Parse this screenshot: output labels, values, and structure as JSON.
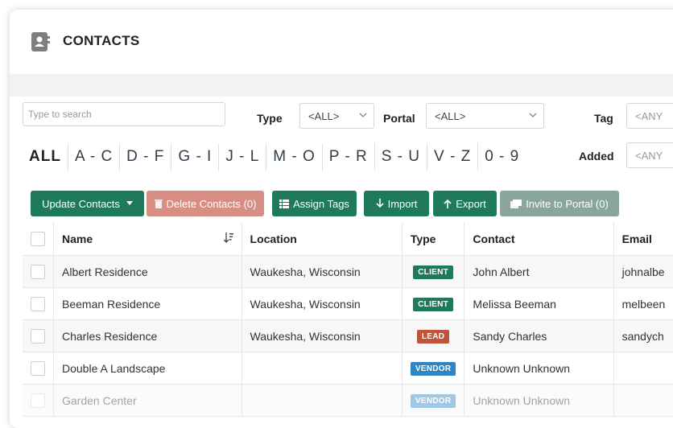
{
  "header": {
    "title": "CONTACTS",
    "icon": "contact-book-icon"
  },
  "filters": {
    "search_placeholder": "Type to search",
    "type_label": "Type",
    "type_value": "<ALL>",
    "portal_label": "Portal",
    "portal_value": "<ALL>",
    "tag_label": "Tag",
    "tag_value": "<ANY",
    "added_label": "Added",
    "added_value": "<ANY"
  },
  "alphabet": [
    "ALL",
    "A - C",
    "D - F",
    "G - I",
    "J - L",
    "M - O",
    "P - R",
    "S - U",
    "V - Z",
    "0 - 9"
  ],
  "toolbar": {
    "update": "Update Contacts",
    "delete": "Delete Contacts (0)",
    "assign": "Assign Tags",
    "import": "Import",
    "export": "Export",
    "invite": "Invite to Portal (0)"
  },
  "table": {
    "columns": [
      "Name",
      "Location",
      "Type",
      "Contact",
      "Email"
    ],
    "rows": [
      {
        "name": "Albert Residence",
        "location": "Waukesha, Wisconsin",
        "type": "CLIENT",
        "contact": "John Albert",
        "email": "johnalbe"
      },
      {
        "name": "Beeman Residence",
        "location": "Waukesha, Wisconsin",
        "type": "CLIENT",
        "contact": "Melissa Beeman",
        "email": "melbeen"
      },
      {
        "name": "Charles Residence",
        "location": "Waukesha, Wisconsin",
        "type": "LEAD",
        "contact": "Sandy Charles",
        "email": "sandych"
      },
      {
        "name": "Double A Landscape",
        "location": "",
        "type": "VENDOR",
        "contact": "Unknown Unknown",
        "email": ""
      },
      {
        "name": "Garden Center",
        "location": "",
        "type": "VENDOR",
        "contact": "Unknown Unknown",
        "email": ""
      }
    ]
  },
  "colors": {
    "primary": "#1f7a5a",
    "danger": "#d88e83",
    "disabled": "#8aa69b",
    "client": "#1f7a5a",
    "lead": "#c0533a",
    "vendor": "#2f86c4"
  }
}
